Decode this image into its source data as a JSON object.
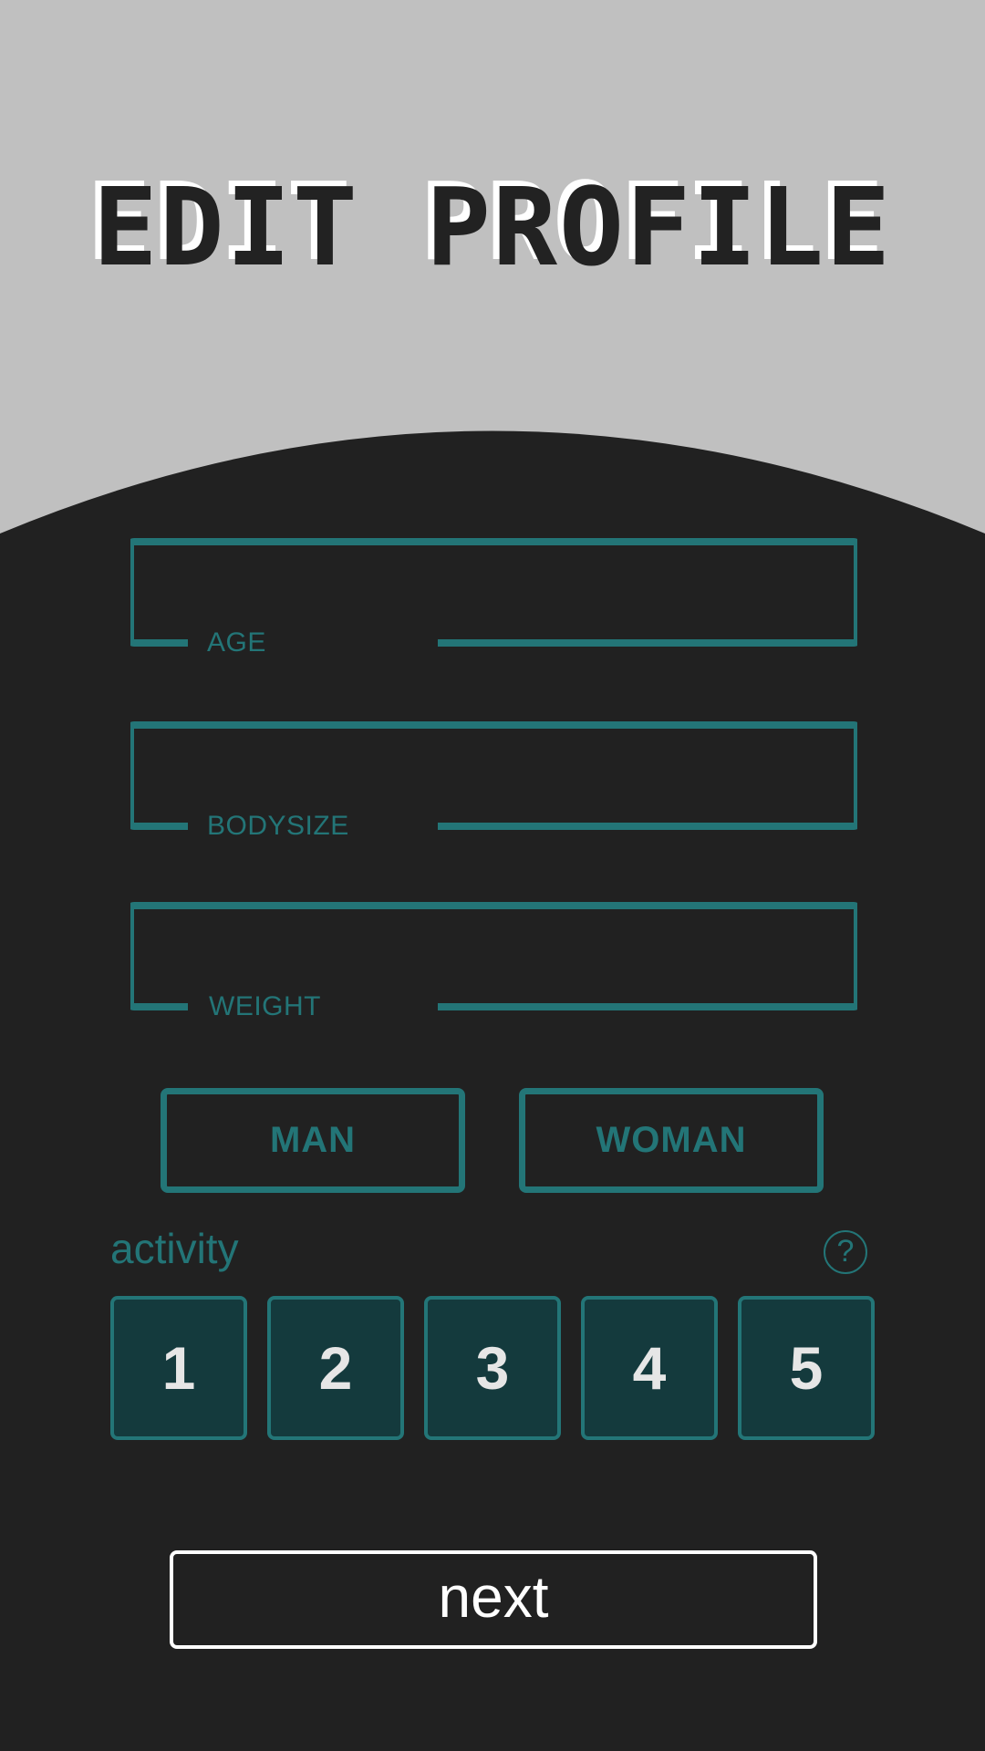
{
  "header": {
    "title": "EDIT PROFILE"
  },
  "form": {
    "fields": [
      {
        "label": "AGE",
        "value": ""
      },
      {
        "label": "BODYSIZE",
        "value": ""
      },
      {
        "label": "WEIGHT",
        "value": ""
      }
    ],
    "gender": {
      "options": [
        "MAN",
        "WOMAN"
      ]
    },
    "activity": {
      "label": "activity",
      "help_icon": "question-circle-icon",
      "options": [
        "1",
        "2",
        "3",
        "4",
        "5"
      ]
    },
    "next_label": "next"
  },
  "colors": {
    "accent": "#237577",
    "background_dark": "#212121",
    "background_light": "#c0c0c0",
    "activity_fill": "#143a3d",
    "text_light": "#ffffff"
  }
}
